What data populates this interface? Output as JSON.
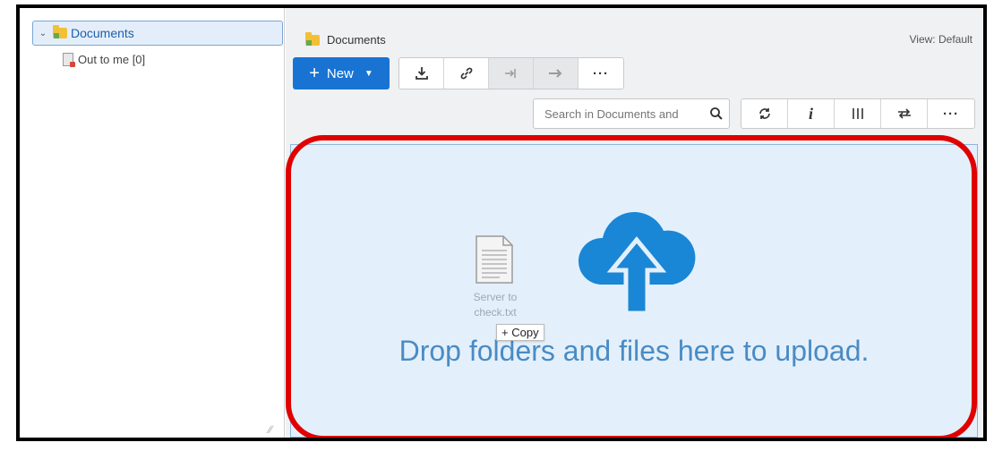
{
  "tree": {
    "root_label": "Documents",
    "child_label": "Out to me [0]"
  },
  "header": {
    "breadcrumb": "Documents",
    "view_label": "View: Default"
  },
  "toolbar": {
    "new_label": "New"
  },
  "search": {
    "placeholder": "Search in Documents and"
  },
  "dropzone": {
    "file_label_line1": "Server to",
    "file_label_line2": "check.txt",
    "copy_label": "Copy",
    "message": "Drop folders and files here to upload."
  },
  "colors": {
    "accent": "#1873d3",
    "highlight_ring": "#e00000",
    "dropzone_bg": "#e3f0fb",
    "cloud": "#1a86d6"
  }
}
